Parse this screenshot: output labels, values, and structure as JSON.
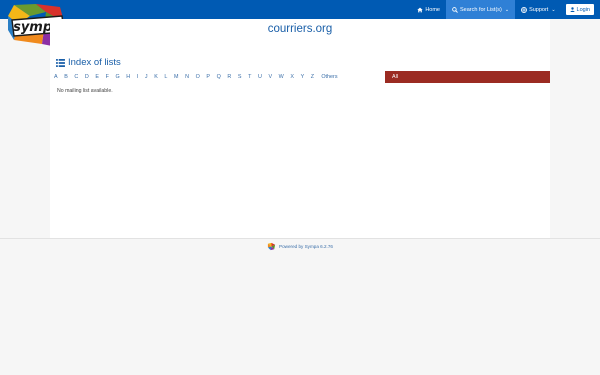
{
  "header": {
    "logo_text": "sympa",
    "nav": {
      "home": "Home",
      "search": "Search for List(s)",
      "support": "Support",
      "login": "Login"
    }
  },
  "main": {
    "site_title": "courriers.org",
    "index_title": "Index of lists",
    "letters": [
      "A",
      "B",
      "C",
      "D",
      "E",
      "F",
      "G",
      "H",
      "I",
      "J",
      "K",
      "L",
      "M",
      "N",
      "O",
      "P",
      "Q",
      "R",
      "S",
      "T",
      "U",
      "V",
      "W",
      "X",
      "Y",
      "Z"
    ],
    "others_label": "Others",
    "all_label": "All",
    "empty_message": "No mailing list available."
  },
  "footer": {
    "powered_by": "Powered by Sympa 6.2.76"
  },
  "colors": {
    "topbar": "#005ab3",
    "active_tab": "#2f80d6",
    "all_tab": "#9b2b22",
    "link": "#3a6ea8"
  },
  "icons": [
    "home-icon",
    "search-icon",
    "support-icon",
    "user-icon",
    "list-icon",
    "sympa-logo"
  ]
}
